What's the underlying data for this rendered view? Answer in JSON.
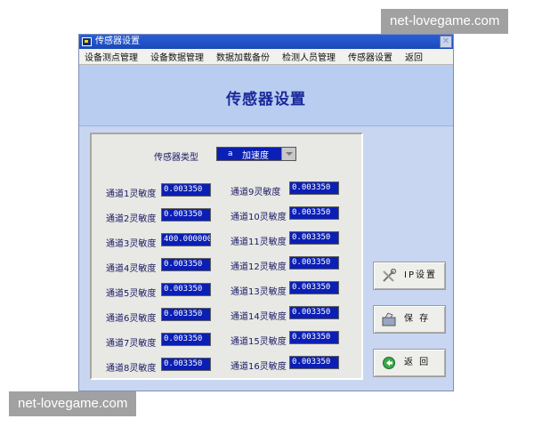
{
  "watermark": {
    "text": "net-lovegame.com"
  },
  "window": {
    "title": "传感器设置"
  },
  "menu": [
    "设备测点管理",
    "设备数据管理",
    "数据加载备份",
    "检测人员管理",
    "传感器设置",
    "返回"
  ],
  "page_title": "传感器设置",
  "sensor_type": {
    "label": "传感器类型",
    "code": "a",
    "value": "加速度"
  },
  "channels_left": [
    {
      "label": "通道1灵敏度",
      "value": "0.003350"
    },
    {
      "label": "通道2灵敏度",
      "value": "0.003350"
    },
    {
      "label": "通道3灵敏度",
      "value": "400.000000"
    },
    {
      "label": "通道4灵敏度",
      "value": "0.003350"
    },
    {
      "label": "通道5灵敏度",
      "value": "0.003350"
    },
    {
      "label": "通道6灵敏度",
      "value": "0.003350"
    },
    {
      "label": "通道7灵敏度",
      "value": "0.003350"
    },
    {
      "label": "通道8灵敏度",
      "value": "0.003350"
    }
  ],
  "channels_right": [
    {
      "label": "通道9灵敏度",
      "value": "0.003350"
    },
    {
      "label": "通道10灵敏度",
      "value": "0.003350"
    },
    {
      "label": "通道11灵敏度",
      "value": "0.003350"
    },
    {
      "label": "通道12灵敏度",
      "value": "0.003350"
    },
    {
      "label": "通道13灵敏度",
      "value": "0.003350"
    },
    {
      "label": "通道14灵敏度",
      "value": "0.003350"
    },
    {
      "label": "通道15灵敏度",
      "value": "0.003350"
    },
    {
      "label": "通道16灵敏度",
      "value": "0.003350"
    }
  ],
  "buttons": {
    "ip": "IP设置",
    "save": "保 存",
    "back": "返 回"
  },
  "colors": {
    "field_bg": "#0b1fb5",
    "title_text": "#1a2a9a",
    "window_bg": "#c8d6f2"
  }
}
